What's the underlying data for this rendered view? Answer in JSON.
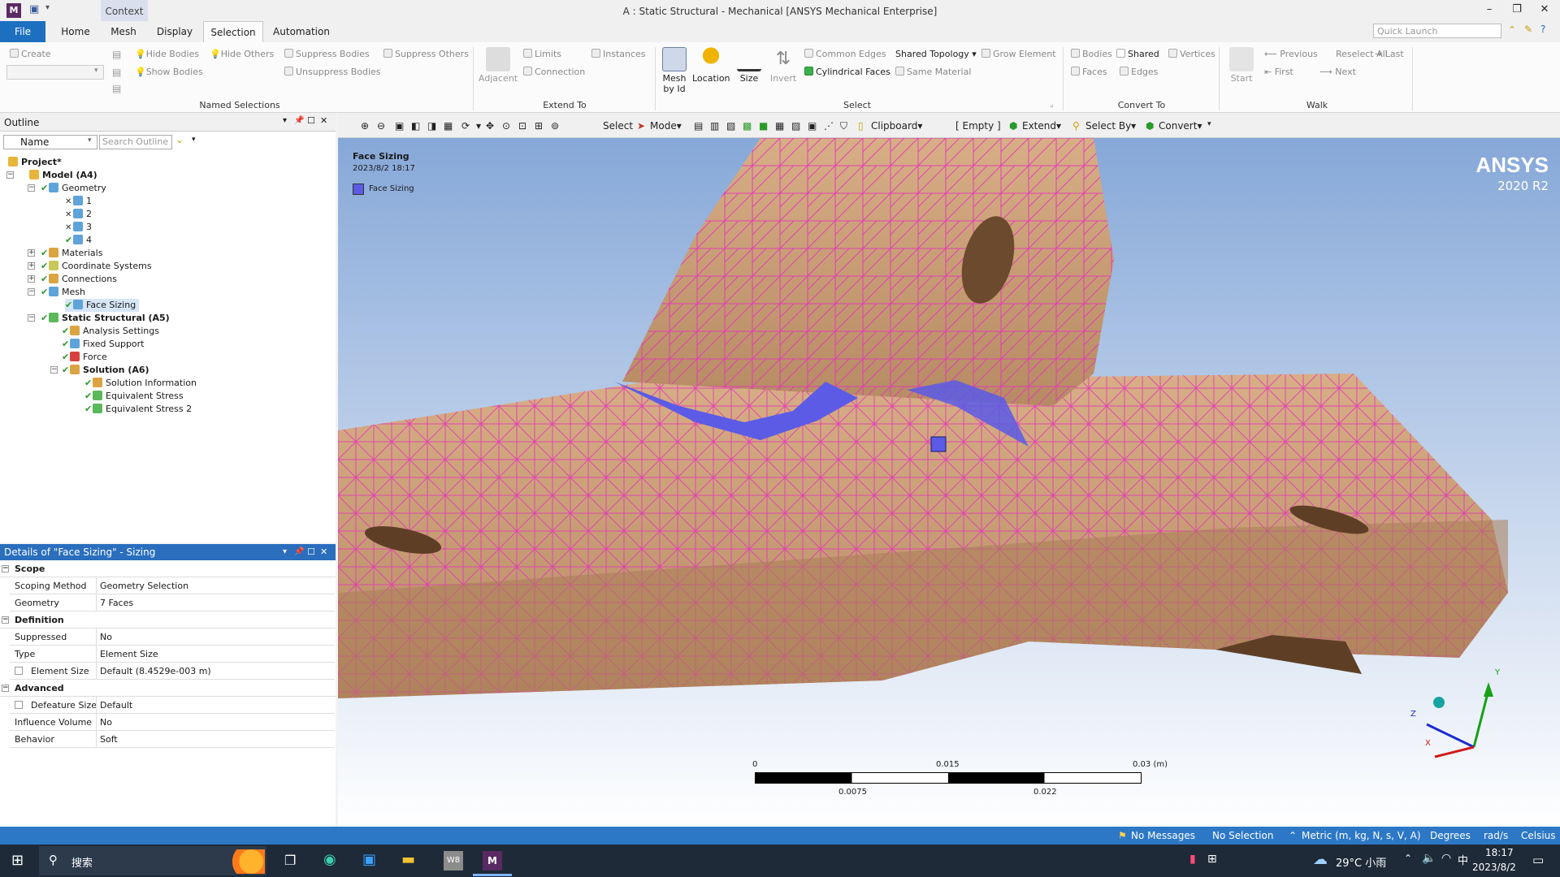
{
  "window": {
    "title": "A : Static Structural - Mechanical [ANSYS Mechanical Enterprise]",
    "app_icon": "M",
    "context_tab": "Context"
  },
  "ribbon_tabs": [
    "File",
    "Home",
    "Mesh",
    "Display",
    "Selection",
    "Automation"
  ],
  "quick_launch_placeholder": "Quick Launch",
  "ribbon": {
    "named_selections": {
      "create": "Create",
      "hide_bodies": "Hide Bodies",
      "hide_others": "Hide Others",
      "show_bodies": "Show Bodies",
      "suppress_bodies": "Suppress Bodies",
      "suppress_others": "Suppress Others",
      "unsuppress_bodies": "Unsuppress Bodies",
      "group": "Named Selections"
    },
    "extend_to": {
      "adjacent": "Adjacent",
      "limits": "Limits",
      "connection": "Connection",
      "instances": "Instances",
      "group": "Extend To"
    },
    "select": {
      "mesh_by_id": "Mesh\nby Id",
      "location": "Location",
      "size": "Size",
      "invert": "Invert",
      "common_edges": "Common Edges",
      "cylindrical_faces": "Cylindrical Faces",
      "shared_topology": "Shared Topology",
      "same_material": "Same Material",
      "grow_element": "Grow Element",
      "group": "Select"
    },
    "convert_to": {
      "bodies": "Bodies",
      "shared": "Shared",
      "vertices": "Vertices",
      "faces": "Faces",
      "edges": "Edges",
      "group": "Convert To"
    },
    "walk": {
      "start": "Start",
      "previous": "Previous",
      "reselect_all": "Reselect All",
      "last": "Last",
      "first": "First",
      "next": "Next",
      "group": "Walk"
    }
  },
  "outline": {
    "title": "Outline",
    "name_filter": "Name",
    "search_placeholder": "Search Outline",
    "tree": [
      {
        "label": "Project*",
        "bold": true
      },
      {
        "label": "Model (A4)",
        "bold": true
      },
      {
        "label": "Geometry"
      },
      {
        "label": "1"
      },
      {
        "label": "2"
      },
      {
        "label": "3"
      },
      {
        "label": "4"
      },
      {
        "label": "Materials"
      },
      {
        "label": "Coordinate Systems"
      },
      {
        "label": "Connections"
      },
      {
        "label": "Mesh"
      },
      {
        "label": "Face Sizing",
        "selected": true
      },
      {
        "label": "Static Structural (A5)",
        "bold": true
      },
      {
        "label": "Analysis Settings"
      },
      {
        "label": "Fixed Support"
      },
      {
        "label": "Force"
      },
      {
        "label": "Solution (A6)",
        "bold": true
      },
      {
        "label": "Solution Information"
      },
      {
        "label": "Equivalent Stress"
      },
      {
        "label": "Equivalent Stress 2"
      }
    ]
  },
  "details": {
    "title": "Details of \"Face Sizing\" - Sizing",
    "sections": {
      "scope": "Scope",
      "definition": "Definition",
      "advanced": "Advanced"
    },
    "rows": {
      "scoping_method": {
        "k": "Scoping Method",
        "v": "Geometry Selection"
      },
      "geometry": {
        "k": "Geometry",
        "v": "7 Faces"
      },
      "suppressed": {
        "k": "Suppressed",
        "v": "No"
      },
      "type": {
        "k": "Type",
        "v": "Element Size"
      },
      "element_size": {
        "k": "Element Size",
        "v": "Default (8.4529e-003 m)"
      },
      "defeature_size": {
        "k": "Defeature Size",
        "v": "Default"
      },
      "influence_volume": {
        "k": "Influence Volume",
        "v": "No"
      },
      "behavior": {
        "k": "Behavior",
        "v": "Soft"
      }
    }
  },
  "graphics_toolbar": {
    "select": "Select",
    "mode": "Mode",
    "clipboard": "Clipboard",
    "empty": "[ Empty ]",
    "extend": "Extend",
    "select_by": "Select By",
    "convert": "Convert"
  },
  "viewport": {
    "annotation_title": "Face Sizing",
    "annotation_date": "2023/8/2 18:17",
    "legend_label": "Face Sizing",
    "legend_color": "#5b5be6",
    "logo_brand": "ANSYS",
    "logo_version": "2020 R2",
    "scale": {
      "t0": "0",
      "t1": "0.015",
      "t2": "0.03 (m)",
      "b1": "0.0075",
      "b2": "0.022"
    },
    "axes": {
      "y": "Y",
      "z": "Z",
      "x": "X"
    },
    "mesh_color": "#e436b8",
    "body_color": "#d2a77f"
  },
  "status": {
    "messages": "No Messages",
    "selection": "No Selection",
    "units": "Metric (m, kg, N, s, V, A)",
    "angle": "Degrees",
    "rate": "rad/s",
    "temp": "Celsius"
  },
  "taskbar": {
    "search": "搜索",
    "weather": "29°C 小雨",
    "time": "18:17",
    "date": "2023/8/2",
    "pinned": [
      "W8"
    ]
  }
}
